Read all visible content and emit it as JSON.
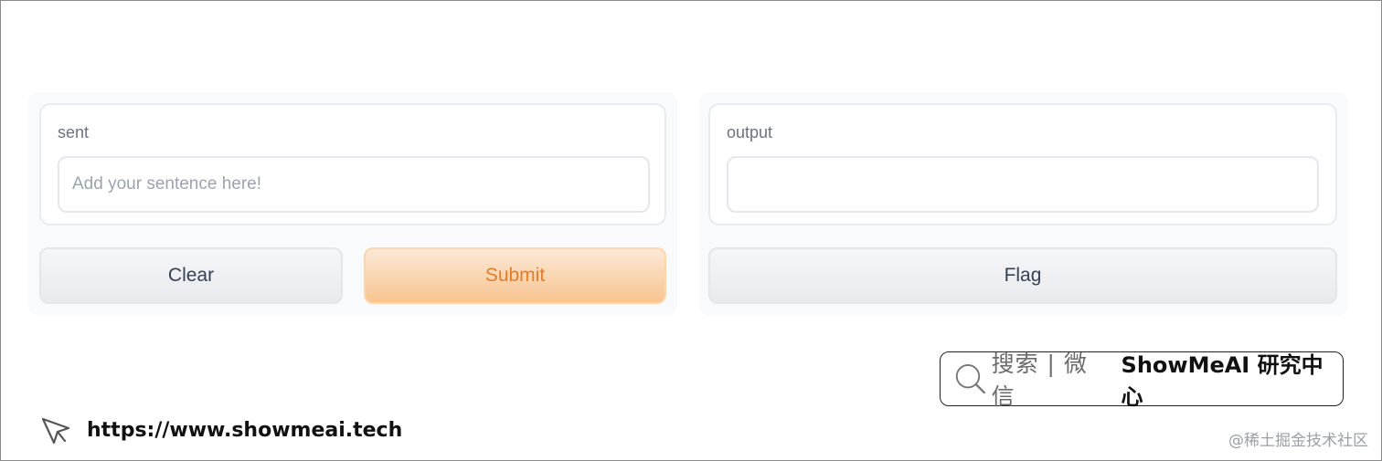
{
  "input_panel": {
    "label": "sent",
    "placeholder": "Add your sentence here!",
    "value": "",
    "clear_label": "Clear",
    "submit_label": "Submit"
  },
  "output_panel": {
    "label": "output",
    "value": "",
    "flag_label": "Flag"
  },
  "search_badge": {
    "cn_text": "搜索 | 微信",
    "brand_text": "ShowMeAI 研究中心"
  },
  "footer": {
    "url": "https://www.showmeai.tech",
    "watermark": "@稀土掘金技术社区"
  },
  "colors": {
    "accent": "#e27d2c",
    "submit_bg": "#f7c48f",
    "panel_bg": "#f9fafb"
  }
}
